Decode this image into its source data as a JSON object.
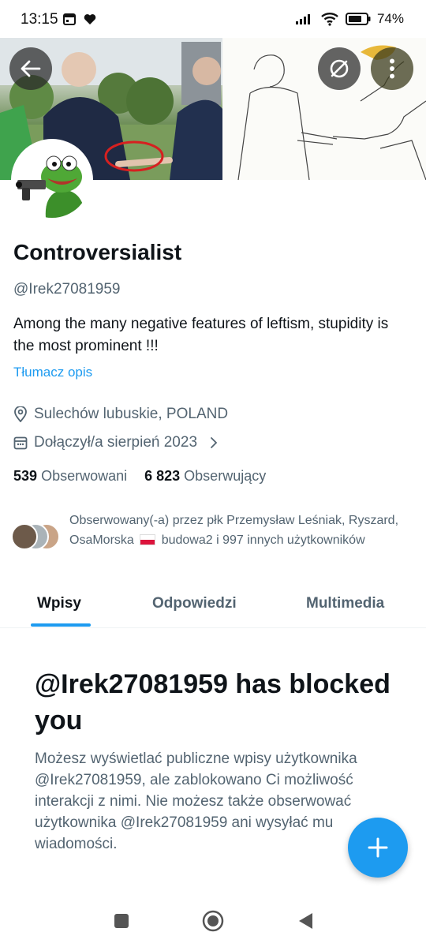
{
  "status_bar": {
    "time": "13:15",
    "battery": "74%",
    "icons": [
      "calendar-icon",
      "heart-icon",
      "signal-icon",
      "wifi-icon",
      "battery-icon"
    ]
  },
  "header": {
    "back_icon": "arrow-left-icon",
    "no_cast_icon": "circle-slash-icon",
    "more_icon": "more-vertical-icon"
  },
  "profile": {
    "display_name": "Controversialist",
    "handle": "@Irek27081959",
    "bio": "Among the many negative features of leftism, stupidity is the most prominent !!!",
    "translate_label": "Tłumacz opis",
    "location": "Sulechów lubuskie, POLAND",
    "joined": "Dołączył/a sierpień 2023",
    "following_count": "539",
    "following_label": "Obserwowani",
    "followers_count": "6 823",
    "followers_label": "Obserwujący",
    "followed_by_before_flag": "Obserwowany(-a) przez płk Przemysław Leśniak, Ryszard, OsaMorska",
    "followed_by_after_flag": "budowa2 i 997 innych użytkowników"
  },
  "tabs": [
    {
      "label": "Wpisy",
      "active": true
    },
    {
      "label": "Odpowiedzi",
      "active": false
    },
    {
      "label": "Multimedia",
      "active": false
    }
  ],
  "blocked": {
    "title": "@Irek27081959 has blocked you",
    "body": "Możesz wyświetlać publiczne wpisy użytkownika @Irek27081959, ale zablokowano Ci możliwość interakcji z nimi. Nie możesz także obserwować użytkownika @Irek27081959 ani wysyłać mu wiadomości."
  },
  "fab": {
    "icon": "plus-icon"
  },
  "colors": {
    "accent": "#1d9bf0",
    "text": "#0f1419",
    "muted": "#536471"
  }
}
